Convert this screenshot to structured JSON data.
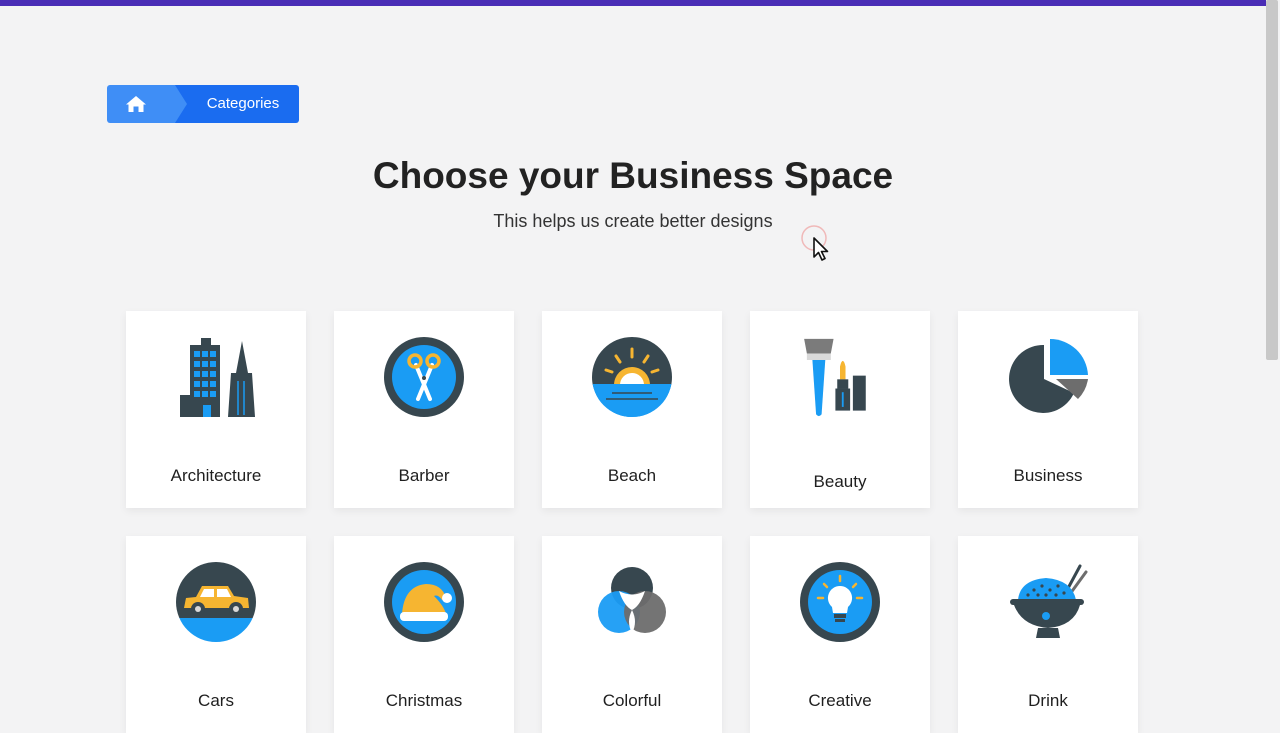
{
  "breadcrumb": {
    "home_icon": "home-icon",
    "current": "Categories"
  },
  "header": {
    "title": "Choose your Business Space",
    "subtitle": "This helps us create better designs"
  },
  "colors": {
    "accent_bar": "#4a2db6",
    "breadcrumb_home": "#3f8ef6",
    "breadcrumb_current": "#1a6cf0",
    "icon_dark": "#37474f",
    "icon_blue": "#1a9cf4",
    "icon_yellow": "#f6b531"
  },
  "categories": [
    {
      "label": "Architecture",
      "icon": "buildings-icon"
    },
    {
      "label": "Barber",
      "icon": "scissors-icon"
    },
    {
      "label": "Beach",
      "icon": "sunset-icon"
    },
    {
      "label": "Beauty",
      "icon": "makeup-icon"
    },
    {
      "label": "Business",
      "icon": "pie-chart-icon"
    },
    {
      "label": "Cars",
      "icon": "car-icon"
    },
    {
      "label": "Christmas",
      "icon": "santa-hat-icon"
    },
    {
      "label": "Colorful",
      "icon": "color-circles-icon"
    },
    {
      "label": "Creative",
      "icon": "lightbulb-icon"
    },
    {
      "label": "Drink",
      "icon": "bowl-icon"
    }
  ]
}
